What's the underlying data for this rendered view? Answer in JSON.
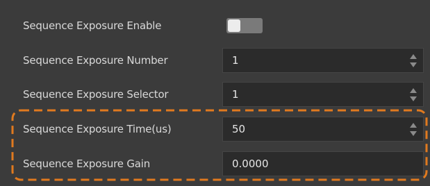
{
  "params": {
    "enable": {
      "label": "Sequence Exposure Enable",
      "value": false
    },
    "number": {
      "label": "Sequence Exposure Number",
      "value": "1"
    },
    "selector": {
      "label": "Sequence Exposure Selector",
      "value": "1"
    },
    "time": {
      "label": "Sequence Exposure Time(us)",
      "value": "50"
    },
    "gain": {
      "label": "Sequence Exposure Gain",
      "value": "0.0000"
    }
  },
  "highlight": {
    "color": "#e07a1f",
    "style": "dashed"
  },
  "colors": {
    "background": "#3b3b3b",
    "field": "#2b2b2b",
    "label": "#d9d9d9",
    "toggle_track": "#7a7a7a"
  },
  "icons": {
    "spinner": "up-down-arrows"
  }
}
